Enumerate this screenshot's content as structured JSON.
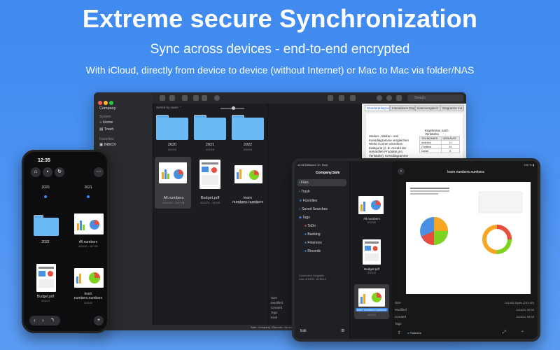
{
  "headline": {
    "title": "Extreme secure Synchronization",
    "subtitle": "Sync across devices - end-to-end encrypted",
    "tagline": "With iCloud, directly from device to device (without Internet) or Mac to Mac via folder/NAS"
  },
  "mac": {
    "sidebar": {
      "group": "Company",
      "section_system": "System",
      "home": "Home",
      "trash": "Trash",
      "section_favorites": "Favorites",
      "inbox": "INBOX"
    },
    "sort_label": "Sorted by name ⌃",
    "files": [
      {
        "name": "2020",
        "sub": "4/2016"
      },
      {
        "name": "2021",
        "sub": "4/2016"
      },
      {
        "name": "2022",
        "sub": "6/2016"
      },
      {
        "name": "All.numbers",
        "sub": "8/10/16 – 167 KB"
      },
      {
        "name": "Budget.pdf",
        "sub": "3/23/23 – 93 KB"
      },
      {
        "name": "learn numbers.numbers",
        "sub": "3/23/23 – 243 KB"
      }
    ],
    "tabs": [
      "Standarddiagramme",
      "Interaktives Diagramm",
      "Datenvergleich",
      "Diagramm mit 2 Achsen"
    ],
    "search_placeholder": "Search",
    "preview": {
      "paragraph": "Säulen-, Balken- und Kreisdiagramme vergleichen Werte in einer einzelnen Kategorie (z. B. Anzahl der verkauften Produkte pro Verkäufer). Kreisdiagramme zeigen jeden Wert einer Kategorie als Prozentsatz des Ganzen.",
      "table_title": "Ergebnisse nach Verkäufen",
      "table_head": [
        "TEILNEHMER",
        "VERKÄUFE"
      ],
      "rows": [
        [
          "Andreas",
          "11"
        ],
        [
          "Christina",
          "15"
        ],
        [
          "Daniel",
          "6"
        ]
      ]
    },
    "meta_labels": [
      "Size",
      "Modified",
      "Created",
      "Tags",
      "Kind"
    ],
    "status_path": "Safe: Company › Reports › All.numbers",
    "status_right": "1 file selected"
  },
  "phone": {
    "time": "12:35",
    "items": [
      {
        "name": "2020",
        "sub": ""
      },
      {
        "name": "2021",
        "sub": ""
      },
      {
        "name": "2022",
        "sub": ""
      },
      {
        "name": "All.numbers",
        "sub": "8/10/16 – 167 KB"
      },
      {
        "name": "Budget.pdf",
        "sub": "3/23/23"
      },
      {
        "name": "learn numbers.numbers",
        "sub": "3/23/23"
      }
    ]
  },
  "ipad": {
    "status_left": "12:36  Mittwoch 10. Sept.",
    "status_right": "100 % ▮",
    "title": "Company.Safe",
    "sidebar": [
      "Files",
      "Trash",
      "Favorites",
      "Saved Searches",
      "Tags",
      "ToDo",
      "Banking",
      "Finances",
      "Records"
    ],
    "files": [
      {
        "name": "All.numbers",
        "sub": "8/10/16"
      },
      {
        "name": "Budget.pdf",
        "sub": "3/23/23"
      },
      {
        "name": "learn numbers.numbers",
        "sub": "3/23/23"
      }
    ],
    "doc_title": "learn numbers.numbers",
    "meta": [
      {
        "label": "Size",
        "value": "243,882 Bytes (243 KB)"
      },
      {
        "label": "Modified",
        "value": "3/23/23, 08:35"
      },
      {
        "label": "Created",
        "value": "3/23/23, 08:35"
      },
      {
        "label": "Tags",
        "value": ""
      }
    ],
    "tag_value": "Finances",
    "footer_left": "Edit",
    "connected": "Connected: KingsMix",
    "last": "Last: 8/10/23, 12:38:15"
  },
  "colors": {
    "accent": "#3f8cf0",
    "folder": "#6bbaf5",
    "red": "#ff5f57",
    "yellow": "#febc2e",
    "green": "#28c840"
  }
}
